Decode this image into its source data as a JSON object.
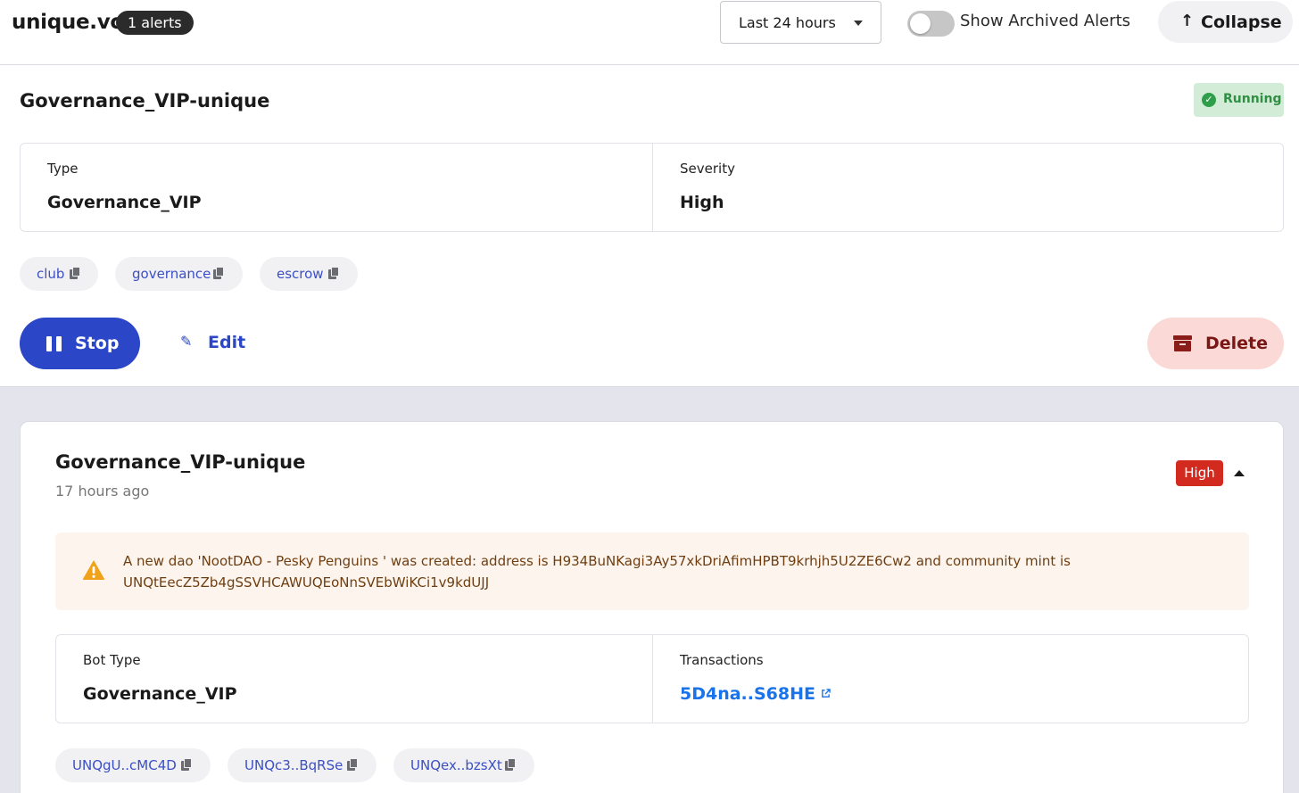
{
  "header": {
    "brand": "unique.vc",
    "alerts_badge": "1 alerts",
    "time_range": {
      "selected": "Last 24 hours"
    },
    "archived_toggle": {
      "label": "Show Archived Alerts",
      "on": false
    },
    "collapse": {
      "icon": "arrow-up-icon",
      "label": "Collapse"
    }
  },
  "bot": {
    "title": "Governance_VIP-unique",
    "status": "Running",
    "type_label": "Type",
    "type_value": "Governance_VIP",
    "severity_label": "Severity",
    "severity_value": "High",
    "tags": [
      "club",
      "governance",
      "escrow"
    ],
    "actions": {
      "stop": "Stop",
      "edit": "Edit",
      "delete": "Delete"
    }
  },
  "alert": {
    "title": "Governance_VIP-unique",
    "time": "17 hours ago",
    "severity": "High",
    "message": "A new dao 'NootDAO - Pesky Penguins ' was created: address is H934BuNKagi3Ay57xkDriAfimHPBT9krhjh5U2ZE6Cw2 and community mint is UNQtEecZ5Zb4gSSVHCAWUQEoNnSVEbWiKCi1v9kdUJJ",
    "bot_type_label": "Bot Type",
    "bot_type_value": "Governance_VIP",
    "transactions_label": "Transactions",
    "transaction": "5D4na..S68HE",
    "addresses": [
      "UNQgU..cMC4D",
      "UNQc3..BqRSe",
      "UNQex..bzsXt"
    ]
  },
  "colors": {
    "primary": "#2b46c6",
    "running_bg": "#d3ecd7",
    "running_text": "#2f8f44",
    "high_badge": "#d32a20",
    "delete_bg": "#fbd9d6",
    "warning_bg": "#fdf5ed",
    "warning_icon": "#f0a21a",
    "link": "#1a73e8",
    "page_bg": "#e3e4ec"
  }
}
